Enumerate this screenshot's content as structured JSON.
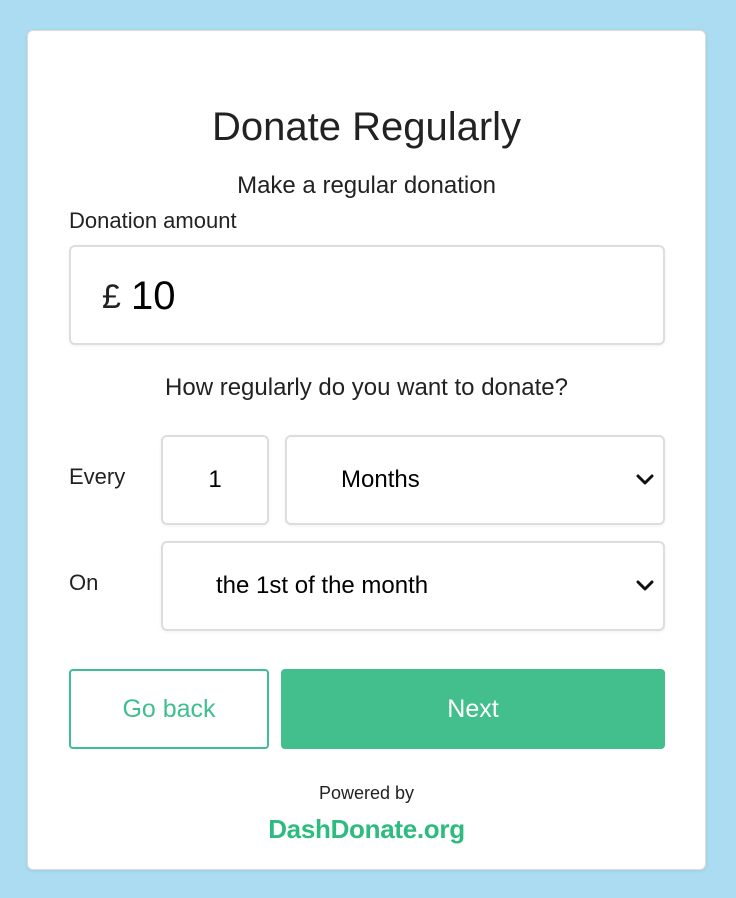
{
  "header": {
    "title": "Donate Regularly",
    "subtitle": "Make a regular donation"
  },
  "amount": {
    "label": "Donation amount",
    "currency_symbol": "£",
    "value": "10"
  },
  "frequency": {
    "question": "How regularly do you want to donate?",
    "every_label": "Every",
    "interval_value": "1",
    "unit_selected": "Months",
    "on_label": "On",
    "day_selected": "the 1st of the month"
  },
  "actions": {
    "back_label": "Go back",
    "next_label": "Next"
  },
  "footer": {
    "powered_by": "Powered by",
    "brand": "DashDonate.org"
  },
  "colors": {
    "background": "#acdcf1",
    "accent": "#42bf8c",
    "card": "#ffffff"
  }
}
